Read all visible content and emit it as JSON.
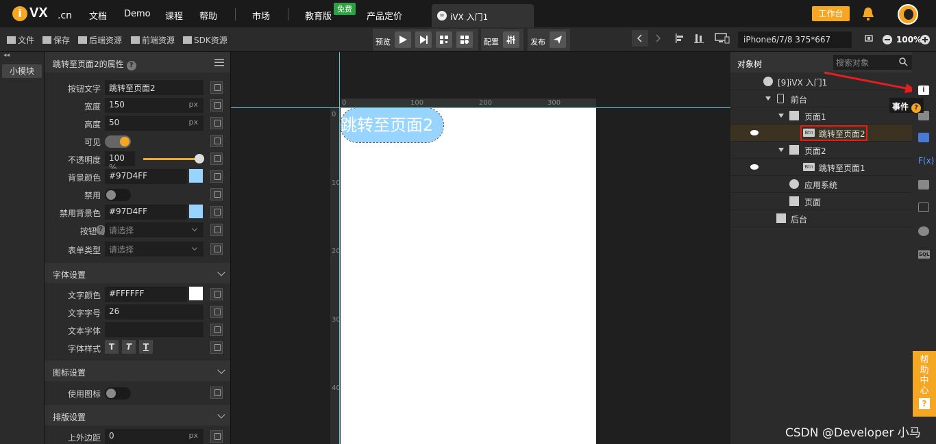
{
  "nav": {
    "logo_text": "VX",
    "logo_suffix": ".cn",
    "items": [
      "文档",
      "Demo",
      "课程",
      "帮助",
      "市场",
      "教育版",
      "产品定价"
    ],
    "free_badge": "免费",
    "tab_title": "iVX 入门1",
    "workbench": "工作台"
  },
  "toolbar": {
    "file": "文件",
    "save": "保存",
    "backend": "后端资源",
    "frontend": "前端资源",
    "sdk": "SDK资源",
    "preview": "预览",
    "config": "配置",
    "publish": "发布",
    "device": "iPhone6/7/8 375*667",
    "zoom": "100%"
  },
  "leftstrip": {
    "module_btn": "小模块"
  },
  "props": {
    "title": "跳转至页面2的属性",
    "rows": {
      "btn_text": {
        "label": "按钮文字",
        "value": "跳转至页面2"
      },
      "width": {
        "label": "宽度",
        "value": "150",
        "unit": "px"
      },
      "height": {
        "label": "高度",
        "value": "50",
        "unit": "px"
      },
      "visible": {
        "label": "可见"
      },
      "opacity": {
        "label": "不透明度",
        "value": "100",
        "unit": "%"
      },
      "bg_color": {
        "label": "背景颜色",
        "value": "#97D4FF"
      },
      "disabled": {
        "label": "禁用"
      },
      "disabled_bg": {
        "label": "禁用背景色",
        "value": "#97D4FF"
      },
      "btn_func": {
        "label": "按钮功能",
        "placeholder": "请选择"
      },
      "form_type": {
        "label": "表单类型",
        "placeholder": "请选择"
      }
    },
    "font_section": "字体设置",
    "font_rows": {
      "color": {
        "label": "文字颜色",
        "value": "#FFFFFF"
      },
      "size": {
        "label": "文字字号",
        "value": "26"
      },
      "family": {
        "label": "文本字体",
        "value": ""
      },
      "style": {
        "label": "字体样式",
        "btns": [
          "T",
          "T",
          "T"
        ]
      }
    },
    "icon_section": "图标设置",
    "icon_row": {
      "label": "使用图标"
    },
    "layout_section": "排版设置",
    "layout_row": {
      "label": "上外边距",
      "value": "0",
      "unit": "px"
    }
  },
  "canvas": {
    "ruler_top": [
      "0",
      "100",
      "200",
      "300"
    ],
    "ruler_left": [
      "0",
      "100",
      "200",
      "300",
      "400"
    ],
    "button_text": "跳转至页面2"
  },
  "tree": {
    "tab": "对象树",
    "search_placeholder": "搜索对象",
    "nodes": {
      "root": "[9]iVX 入门1",
      "front": "前台",
      "page1": "页面1",
      "btn2": "跳转至页面2",
      "page2": "页面2",
      "btn1": "跳转至页面1",
      "appsys": "应用系统",
      "page": "页面",
      "back": "后台"
    }
  },
  "rightbar": {
    "tooltip": "事件",
    "fx": "F(x)",
    "sql": "SQL"
  },
  "help": {
    "label": "帮助中心"
  },
  "watermark": "CSDN @Developer 小马",
  "colors": {
    "accent": "#f5a623",
    "button_bg": "#97D4FF",
    "highlight": "#e0201f"
  }
}
